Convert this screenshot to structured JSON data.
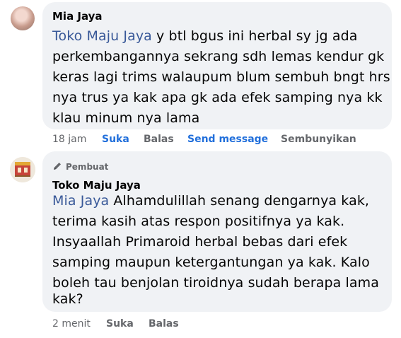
{
  "comment1": {
    "author": "Mia Jaya",
    "mention": "Toko Maju Jaya",
    "lines": [
      " y btl bgus ini herbal sy jg ada",
      "perkembangannya sekrang sdh lemas kendur gk",
      "keras lagi trims walaupum blum sembuh bngt hrs",
      "nya trus ya kak apa gk ada efek samping nya kk",
      "klau minum nya lama"
    ],
    "time": "18 jam",
    "actions": {
      "like": "Suka",
      "reply": "Balas",
      "send": "Send message",
      "hide": "Sembunyikan"
    }
  },
  "comment2": {
    "badge": "Pembuat",
    "author": "Toko Maju Jaya",
    "mention": "Mia Jaya",
    "lines": [
      " Alhamdulillah senang dengarnya kak,",
      "terima kasih atas respon positifnya ya kak.",
      "Insyaallah Primaroid herbal bebas dari efek",
      "samping maupun ketergantungan ya kak. Kalo",
      "boleh tau benjolan tiroidnya sudah berapa lama",
      "kak?"
    ],
    "time": "2 menit",
    "actions": {
      "like": "Suka",
      "reply": "Balas"
    }
  },
  "colors": {
    "bubble": "#f0f2f5",
    "mention": "#385898",
    "link_blue": "#216fdb",
    "meta": "#65676b"
  },
  "icons": {
    "author_badge": "pencil-icon"
  }
}
